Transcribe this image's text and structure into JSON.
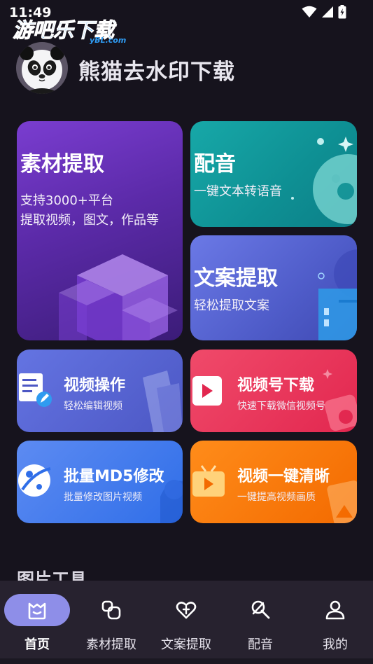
{
  "status_bar": {
    "time": "11:49"
  },
  "watermark": {
    "text": "游吧乐下载",
    "sub": "yBL.com"
  },
  "header": {
    "app_title": "熊猫去水印下载"
  },
  "cards": {
    "sucai": {
      "title": "素材提取",
      "line1": "支持3000+平台",
      "line2": "提取视频，图文，作品等"
    },
    "peiyin": {
      "title": "配音",
      "subtitle": "一键文本转语音"
    },
    "wenan": {
      "title": "文案提取",
      "subtitle": "轻松提取文案"
    },
    "shipin": {
      "title": "视频操作",
      "subtitle": "轻松编辑视频"
    },
    "shipinhao": {
      "title": "视频号下载",
      "subtitle": "快速下载微信视频号"
    },
    "piliang": {
      "title": "批量MD5修改",
      "subtitle": "批量修改图片视频"
    },
    "qingxi": {
      "title": "视频一键清晰",
      "subtitle": "一键提高视频画质"
    }
  },
  "section": {
    "title": "图片工具"
  },
  "bottom_nav": {
    "items": [
      {
        "label": "首页",
        "icon": "home-icon",
        "active": true
      },
      {
        "label": "素材提取",
        "icon": "material-icon",
        "active": false
      },
      {
        "label": "文案提取",
        "icon": "text-extract-icon",
        "active": false
      },
      {
        "label": "配音",
        "icon": "dubbing-icon",
        "active": false
      },
      {
        "label": "我的",
        "icon": "profile-icon",
        "active": false
      }
    ]
  },
  "colors": {
    "background": "#16131d",
    "nav_background": "#27222f",
    "nav_active_pill": "#8e8ee8",
    "card_sucai": "#6a33c0",
    "card_peiyin": "#12a0a3",
    "card_wenan": "#5664d4",
    "card_shipin": "#5865d2",
    "card_shipinhao": "#ea3a5e",
    "card_piliang": "#4a7ef0",
    "card_qingxi": "#f97c0c"
  }
}
